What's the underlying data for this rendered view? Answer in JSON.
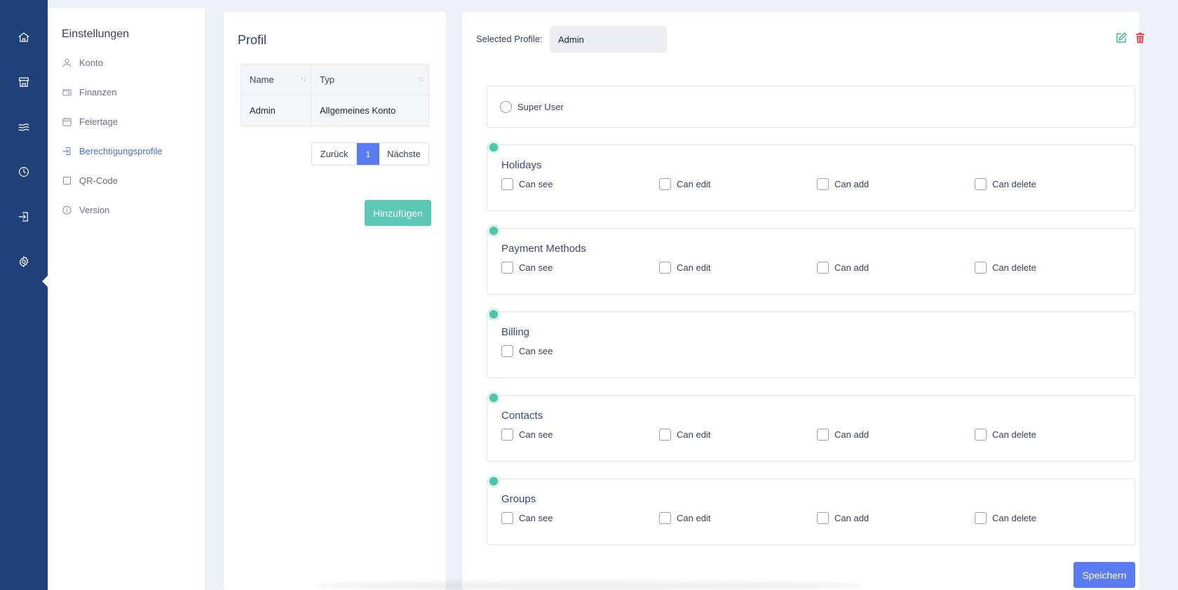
{
  "settings": {
    "title": "Einstellungen",
    "items": [
      {
        "label": "Konto",
        "icon": "user-icon"
      },
      {
        "label": "Finanzen",
        "icon": "wallet-icon"
      },
      {
        "label": "Feiertage",
        "icon": "calendar-icon"
      },
      {
        "label": "Berechtigungsprofile",
        "icon": "login-icon",
        "active": true
      },
      {
        "label": "QR-Code",
        "icon": "square-icon"
      },
      {
        "label": "Version",
        "icon": "info-icon"
      }
    ]
  },
  "rail": {
    "icons": [
      "home-icon",
      "store-icon",
      "waves-icon",
      "clock-icon",
      "login-icon",
      "gear-icon"
    ],
    "active": "gear-icon"
  },
  "profile": {
    "title": "Profil",
    "columns": [
      "Name",
      "Typ"
    ],
    "rows": [
      [
        "Admin",
        "Allgemeines Konto"
      ]
    ],
    "pager": {
      "prev": "Zurück",
      "page": "1",
      "next": "Nächste"
    },
    "add_label": "Hinzufügen"
  },
  "permissions": {
    "selected_label": "Selected Profile:",
    "selected_value": "Admin",
    "superuser_label": "Super User",
    "groups": [
      {
        "title": "Holidays",
        "options": [
          "Can see",
          "Can edit",
          "Can add",
          "Can delete"
        ]
      },
      {
        "title": "Payment Methods",
        "options": [
          "Can see",
          "Can edit",
          "Can add",
          "Can delete"
        ]
      },
      {
        "title": "Billing",
        "options": [
          "Can see"
        ]
      },
      {
        "title": "Contacts",
        "options": [
          "Can see",
          "Can edit",
          "Can add",
          "Can delete"
        ]
      },
      {
        "title": "Groups",
        "options": [
          "Can see",
          "Can edit",
          "Can add",
          "Can delete"
        ]
      }
    ],
    "save_label": "Speichern"
  },
  "colors": {
    "rail": "#20407a",
    "accent": "#5b7cf0",
    "teal": "#5ac8b5",
    "danger": "#e04a4a"
  }
}
